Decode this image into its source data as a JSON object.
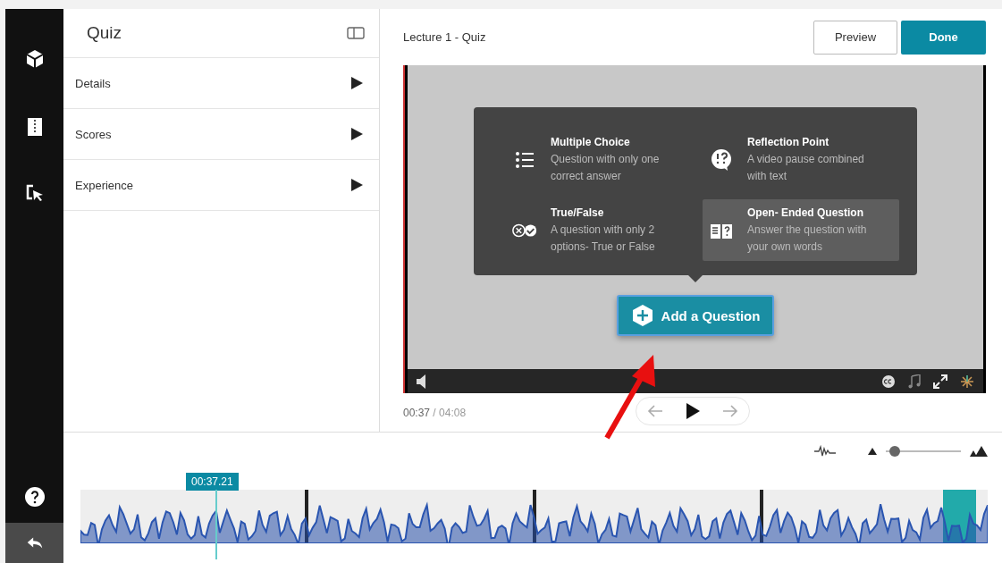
{
  "panel": {
    "title": "Quiz",
    "items": [
      {
        "label": "Details",
        "expanded": false
      },
      {
        "label": "Scores",
        "expanded": false
      },
      {
        "label": "Experience",
        "expanded": false
      }
    ]
  },
  "header": {
    "title": "Lecture 1 - Quiz",
    "buttons": [
      {
        "label": "Preview",
        "kind": "secondary"
      },
      {
        "label": "Done",
        "kind": "primary"
      }
    ]
  },
  "question_types": [
    {
      "kind": "list",
      "title": "Multiple Choice",
      "description": "Question with only one correct answer",
      "selected": false
    },
    {
      "kind": "reflection",
      "title": "Reflection Point",
      "description": "A video pause combined with text",
      "selected": false
    },
    {
      "kind": "truefalse",
      "title": "True/False",
      "description": "A question with only 2 options- True or False",
      "selected": false
    },
    {
      "kind": "open",
      "title": "Open- Ended Question",
      "description": "Answer the question with your own words",
      "selected": true
    }
  ],
  "add_button": {
    "label": "Add a Question"
  },
  "playback": {
    "current": "00:37",
    "separator": "/",
    "total": "04:08"
  },
  "timeline": {
    "zoom": {
      "level": 0.05
    },
    "playhead": "00:37.21"
  }
}
